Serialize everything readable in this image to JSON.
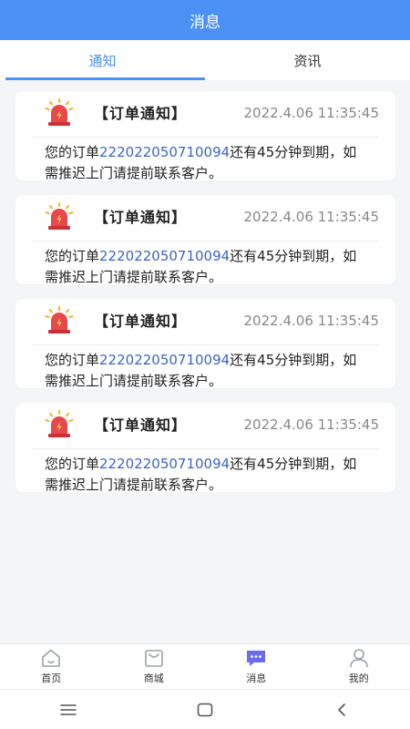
{
  "header": {
    "title": "消息"
  },
  "tabs": [
    {
      "label": "通知",
      "active": true
    },
    {
      "label": "资讯",
      "active": false
    }
  ],
  "notifications": [
    {
      "title": "【订单通知】",
      "time": "2022.4.06 11:35:45",
      "text_before": "您的订单",
      "order_no": "222022050710094",
      "text_after": "还有45分钟到期，如需推迟上门请提前联系客户。"
    },
    {
      "title": "【订单通知】",
      "time": "2022.4.06 11:35:45",
      "text_before": "您的订单",
      "order_no": "222022050710094",
      "text_after": "还有45分钟到期，如需推迟上门请提前联系客户。"
    },
    {
      "title": "【订单通知】",
      "time": "2022.4.06 11:35:45",
      "text_before": "您的订单",
      "order_no": "222022050710094",
      "text_after": "还有45分钟到期，如需推迟上门请提前联系客户。"
    },
    {
      "title": "【订单通知】",
      "time": "2022.4.06 11:35:45",
      "text_before": "您的订单",
      "order_no": "222022050710094",
      "text_after": "还有45分钟到期，如需推迟上门请提前联系客户。"
    }
  ],
  "tabbar": [
    {
      "label": "首页",
      "icon": "home-icon",
      "active": false
    },
    {
      "label": "商城",
      "icon": "shop-icon",
      "active": false
    },
    {
      "label": "消息",
      "icon": "message-icon",
      "active": true
    },
    {
      "label": "我的",
      "icon": "user-icon",
      "active": false
    }
  ],
  "colors": {
    "accent": "#4a90f5",
    "link": "#3b64c8",
    "alarm": "#e8484a"
  }
}
